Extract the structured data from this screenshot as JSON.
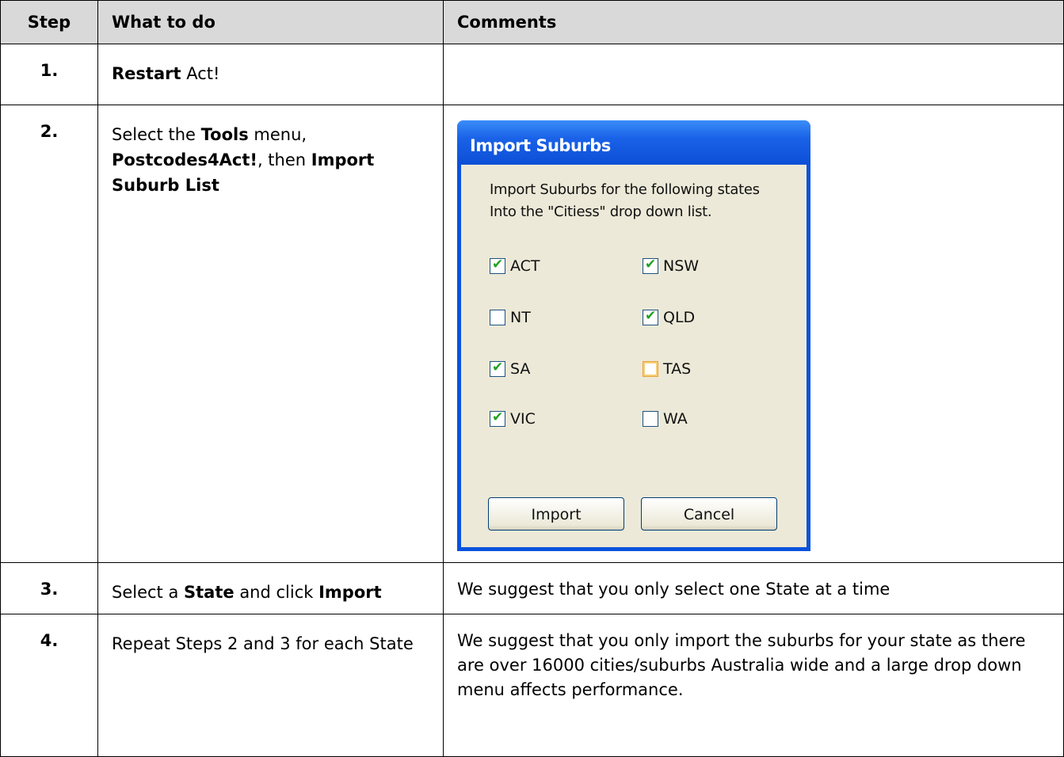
{
  "headers": [
    "Step",
    "What to do",
    "Comments"
  ],
  "rows": [
    {
      "step": "1.",
      "what": [
        {
          "b": "Restart"
        },
        {
          "t": " Act!"
        }
      ],
      "comment": ""
    },
    {
      "step": "2.",
      "what": [
        {
          "t": "Select the "
        },
        {
          "b": "Tools"
        },
        {
          "t": " menu, "
        },
        {
          "b": "Postcodes4Act!"
        },
        {
          "t": ", then "
        },
        {
          "b": "Import Suburb List"
        }
      ],
      "comment": ""
    },
    {
      "step": "3.",
      "what": [
        {
          "t": "Select a "
        },
        {
          "b": "State"
        },
        {
          "t": " and click "
        },
        {
          "b": "Import"
        }
      ],
      "comment": "We suggest that you only select one State at a time"
    },
    {
      "step": "4.",
      "what": [
        {
          "t": "Repeat Steps 2 and 3 for each State"
        }
      ],
      "comment": "We suggest that you only import the suburbs for your state as there are over 16000 cities/suburbs Australia wide and a large drop down menu affects performance."
    }
  ],
  "dialog": {
    "title": "Import Suburbs",
    "intro_line1": "Import Suburbs for the following states",
    "intro_line2": "Into the \"Citiess\" drop down list.",
    "checkboxes": [
      {
        "label": "ACT",
        "checked": true
      },
      {
        "label": "NSW",
        "checked": true
      },
      {
        "label": "NT",
        "checked": false
      },
      {
        "label": "QLD",
        "checked": true
      },
      {
        "label": "SA",
        "checked": true
      },
      {
        "label": "TAS",
        "checked": false,
        "focused": true
      },
      {
        "label": "VIC",
        "checked": true
      },
      {
        "label": "WA",
        "checked": false
      }
    ],
    "import_label": "Import",
    "cancel_label": "Cancel"
  }
}
